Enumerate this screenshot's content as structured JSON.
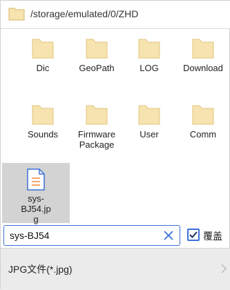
{
  "path": "/storage/emulated/0/ZHD",
  "items": [
    {
      "label": "Dic",
      "type": "folder"
    },
    {
      "label": "GeoPath",
      "type": "folder"
    },
    {
      "label": "LOG",
      "type": "folder"
    },
    {
      "label": "Download",
      "type": "folder"
    },
    {
      "label": "Sounds",
      "type": "folder"
    },
    {
      "label": "Firmware Package",
      "type": "folder"
    },
    {
      "label": "User",
      "type": "folder"
    },
    {
      "label": "Comm",
      "type": "folder"
    },
    {
      "label": "sys-BJ54.jpg",
      "type": "file",
      "selected": true
    }
  ],
  "filename_value": "sys-BJ54",
  "overwrite_label": "覆盖",
  "overwrite_checked": true,
  "filter_label": "JPG文件(*.jpg)",
  "colors": {
    "folder": "#f6e3b0",
    "folder_edge": "#e2c47a",
    "accent": "#3a6fd8",
    "file_lines": "#f08a3c",
    "selected_bg": "#d3d3d3"
  }
}
